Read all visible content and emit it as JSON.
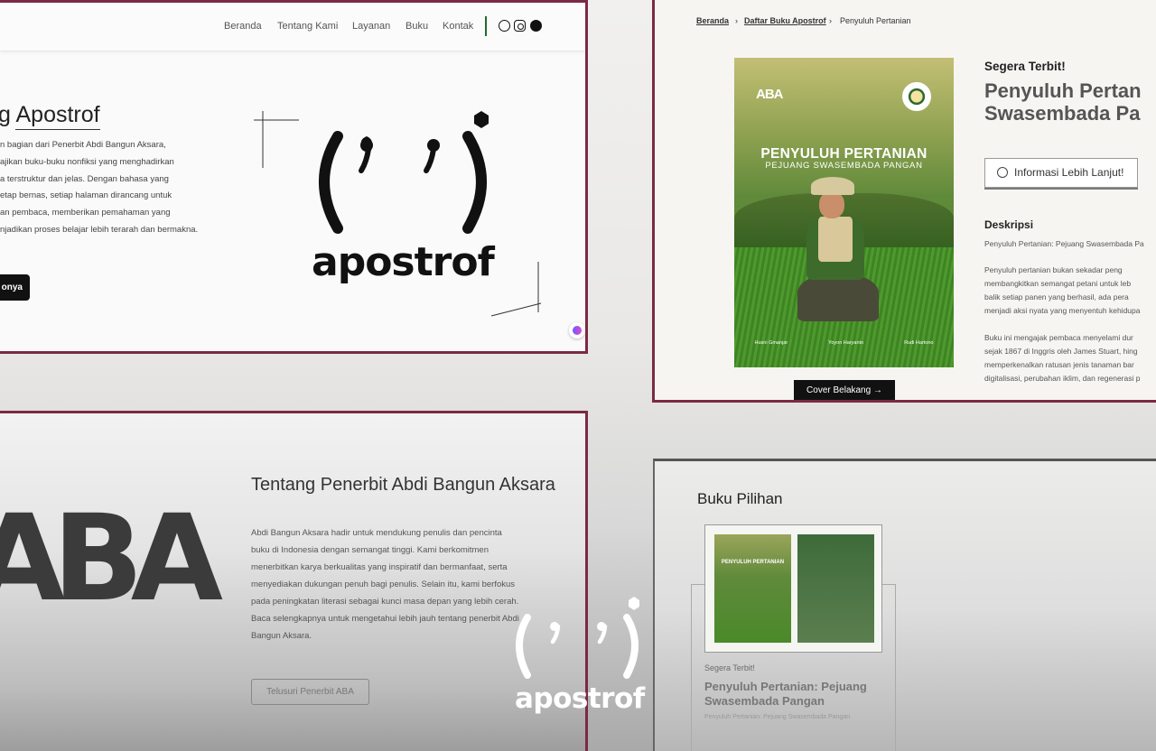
{
  "panel1": {
    "nav": [
      "Beranda",
      "Tentang Kami",
      "Layanan",
      "Buku",
      "Kontak"
    ],
    "title_prefix": "g ",
    "title_word": "Apostrof",
    "intro_lines": [
      "n bagian dari Penerbit Abdi Bangun Aksara,",
      "ajikan buku-buku nonfiksi yang menghadirkan",
      "a terstruktur dan jelas. Dengan bahasa yang",
      "etap bernas, setiap halaman dirancang untuk",
      "an pembaca, memberikan pemahaman yang",
      "njadikan proses belajar lebih terarah dan bermakna."
    ],
    "cta": "onya",
    "logo_word": "apostrof"
  },
  "panel2": {
    "breadcrumb": [
      "Beranda",
      "Daftar Buku Apostrof",
      "Penyuluh Pertanian"
    ],
    "cover": {
      "publisher": "ABA",
      "title": "PENYULUH PERTANIAN",
      "subtitle": "PEJUANG SWASEMBADA PANGAN",
      "authors": [
        "Husni Gmanjar",
        "Yoyon Haryanto",
        "Rudi Hartono"
      ]
    },
    "back_cover_btn": "Cover Belakang →",
    "soon": "Segera Terbit!",
    "title_l1": "Penyuluh Pertan",
    "title_l2": "Swasembada Pa",
    "info_btn": "Informasi Lebih Lanjut!",
    "desc_heading": "Deskripsi",
    "desc_lines": [
      "Penyuluh Pertanian: Pejuang Swasembada Pa",
      "Penyuluh pertanian bukan sekadar peng",
      "membangkitkan semangat petani untuk leb",
      "balik setiap panen yang berhasil, ada pera",
      "menjadi aksi nyata yang menyentuh kehidupa",
      "Buku ini mengajak pembaca menyelami dur",
      "sejak 1867 di Inggris oleh James Stuart, hing",
      "memperkenalkan ratusan jenis tanaman bar",
      "digitalisasi, perubahan iklim, dan regenerasi p"
    ]
  },
  "panel3": {
    "logo": "ABA",
    "heading": "Tentang Penerbit Abdi Bangun Aksara",
    "lines": [
      "Abdi Bangun Aksara hadir untuk mendukung penulis dan pencinta",
      "buku di Indonesia dengan semangat tinggi. Kami berkomitmen",
      "menerbitkan karya berkualitas yang inspiratif dan bermanfaat, serta",
      "menyediakan dukungan penuh bagi penulis. Selain itu, kami berfokus",
      "pada peningkatan literasi sebagai kunci masa depan yang lebih cerah.",
      "Baca selengkapnya untuk mengetahui lebih jauh tentang penerbit Abdi",
      "Bangun Aksara."
    ],
    "button": "Telusuri Penerbit ABA"
  },
  "panel4": {
    "heading": "Buku Pilihan",
    "mini_title": "PENYULUH PERTANIAN",
    "soon": "Segera Terbit!",
    "title": "Penyuluh Pertanian: Pejuang Swasembada Pangan",
    "blurb": "Penyuluh Pertanian: Pejuang Swasembada Pangan"
  },
  "overlay_logo": "apostrof",
  "colors": {
    "border": "#7a2a44",
    "accent_green": "#1f6b2e",
    "dark": "#111111"
  }
}
